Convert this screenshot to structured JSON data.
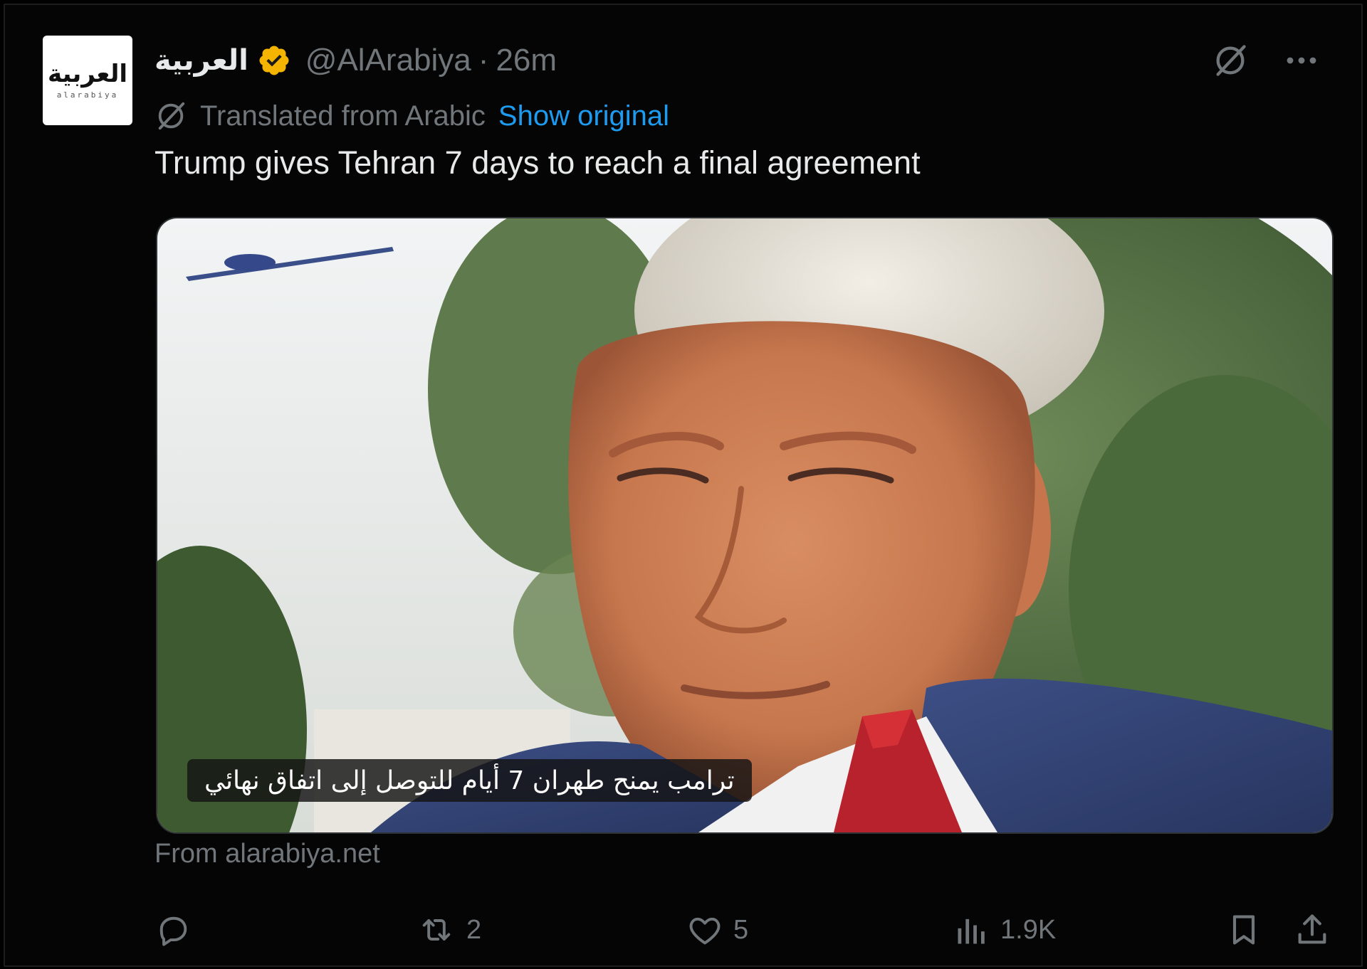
{
  "post": {
    "avatar": {
      "logo_ar": "العربية",
      "logo_en": "alarabiya"
    },
    "display_name": "العربية",
    "handle": "@AlArabiya",
    "separator": "·",
    "time": "26m",
    "translation": {
      "label": "Translated from Arabic",
      "show_original": "Show original"
    },
    "text": "Trump gives Tehran 7 days to reach a final agreement",
    "media": {
      "caption": "ترامب يمنح طهران 7 أيام للتوصل إلى اتفاق نهائي"
    },
    "source": "From alarabiya.net",
    "actions": {
      "reply_count": "",
      "repost_count": "2",
      "like_count": "5",
      "views_count": "1.9K"
    },
    "icons": {
      "verified": "verified-badge-icon",
      "grok": "grok-icon",
      "more": "more-icon",
      "translate": "translate-icon",
      "reply": "reply-icon",
      "repost": "repost-icon",
      "like": "heart-icon",
      "views": "views-icon",
      "bookmark": "bookmark-icon",
      "share": "share-icon"
    },
    "colors": {
      "background": "#050505",
      "text": "#e7e9ea",
      "muted": "#71767b",
      "link": "#1d9bf0",
      "verified": "#f4b400"
    }
  }
}
